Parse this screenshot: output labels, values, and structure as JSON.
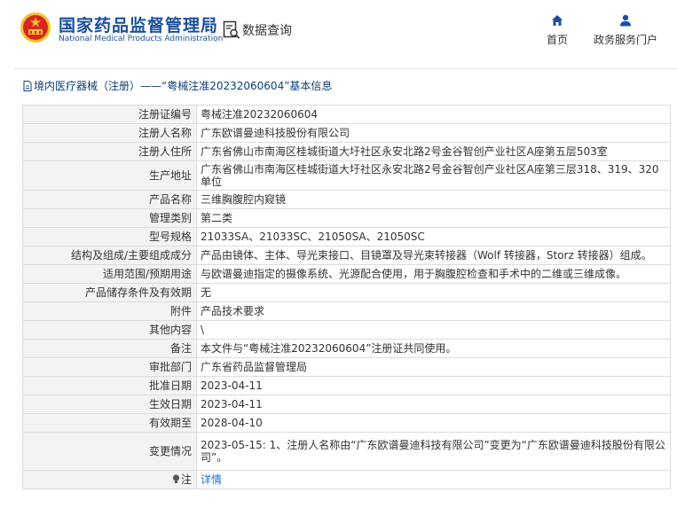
{
  "header": {
    "logo_cn": "国家药品监督管理局",
    "logo_en": "National Medical Products Administration",
    "data_query": "数据查询",
    "nav_home": "首页",
    "nav_portal": "政务服务门户"
  },
  "breadcrumb": "境内医疗器械（注册）——“粤械注准20232060604”基本信息",
  "rows": [
    {
      "label": "注册证编号",
      "value": "粤械注准20232060604"
    },
    {
      "label": "注册人名称",
      "value": "广东欧谱曼迪科技股份有限公司"
    },
    {
      "label": "注册人住所",
      "value": "广东省佛山市南海区桂城街道大圩社区永安北路2号金谷智创产业社区A座第五层503室"
    },
    {
      "label": "生产地址",
      "value": "广东省佛山市南海区桂城街道大圩社区永安北路2号金谷智创产业社区A座第三层318、319、320单位"
    },
    {
      "label": "产品名称",
      "value": "三维胸腹腔内窥镜"
    },
    {
      "label": "管理类别",
      "value": "第二类"
    },
    {
      "label": "型号规格",
      "value": "21033SA、21033SC、21050SA、21050SC"
    },
    {
      "label": "结构及组成/主要组成成分",
      "value": "产品由镜体、主体、导光束接口、目镜罩及导光束转接器（Wolf 转接器，Storz 转接器）组成。"
    },
    {
      "label": "适用范围/预期用途",
      "value": "与欧谱曼迪指定的摄像系统、光源配合使用，用于胸腹腔检查和手术中的二维或三维成像。"
    },
    {
      "label": "产品储存条件及有效期",
      "value": "无"
    },
    {
      "label": "附件",
      "value": "产品技术要求"
    },
    {
      "label": "其他内容",
      "value": "\\"
    },
    {
      "label": "备注",
      "value": "本文件与“粤械注准20232060604”注册证共同使用。"
    },
    {
      "label": "审批部门",
      "value": "广东省药品监督管理局"
    },
    {
      "label": "批准日期",
      "value": "2023-04-11"
    },
    {
      "label": "生效日期",
      "value": "2023-04-11"
    },
    {
      "label": "有效期至",
      "value": "2028-04-10"
    },
    {
      "label": "变更情况",
      "value": "2023-05-15: 1、注册人名称由“广东欧谱曼迪科技有限公司”变更为“广东欧谱曼迪科技股份有限公司”。"
    }
  ],
  "note_row": {
    "label": "注",
    "link": "详情"
  },
  "colors": {
    "brand_blue": "#1b4f9c",
    "link_blue": "#2a6fc9",
    "emblem_red": "#d7261e",
    "emblem_gold": "#f2c12e"
  },
  "icons": [
    "emblem-icon",
    "data-query-icon",
    "home-icon",
    "user-icon",
    "document-icon",
    "info-bulb-icon"
  ]
}
